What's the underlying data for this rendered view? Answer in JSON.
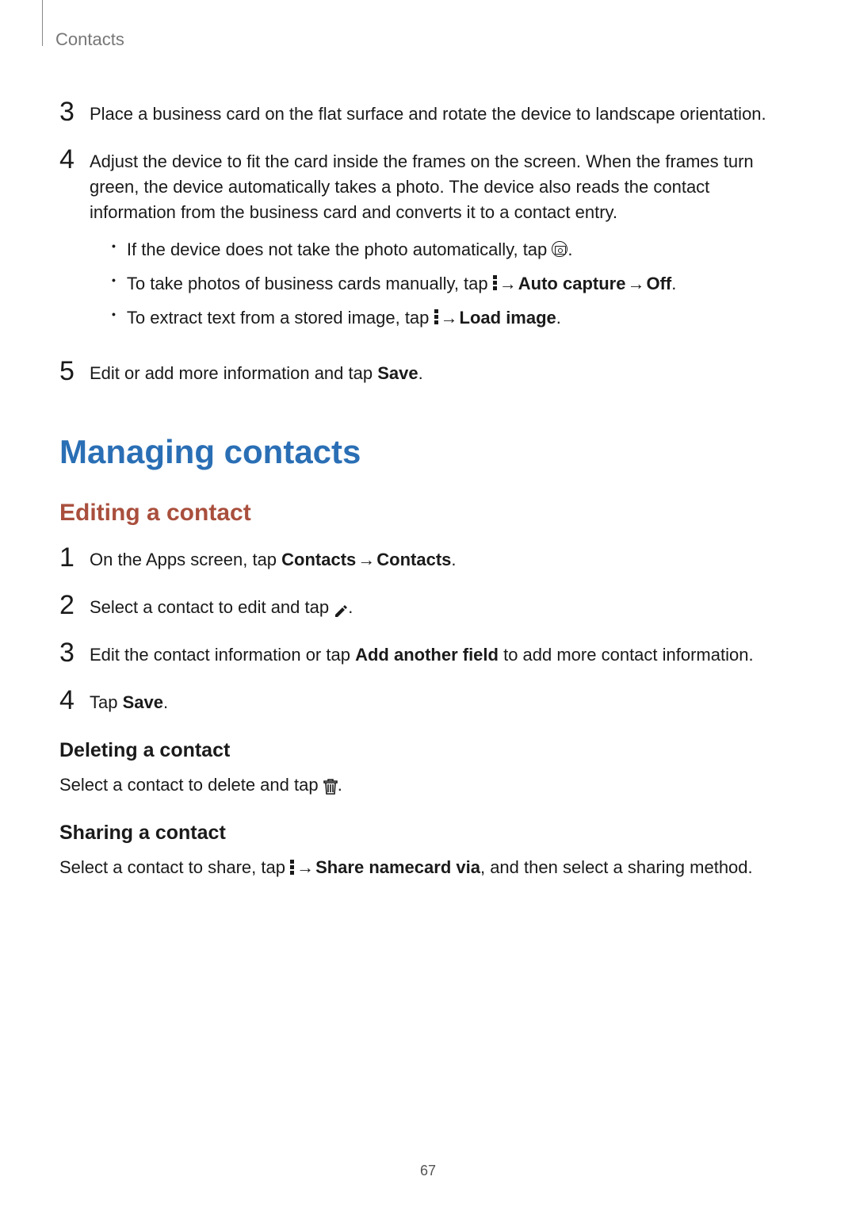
{
  "header": {
    "section_title": "Contacts"
  },
  "steps_first": {
    "3": {
      "num": "3",
      "text": "Place a business card on the flat surface and rotate the device to landscape orientation."
    },
    "4": {
      "num": "4",
      "text": "Adjust the device to fit the card inside the frames on the screen. When the frames turn green, the device automatically takes a photo. The device also reads the contact information from the business card and converts it to a contact entry.",
      "bullets": {
        "a_pre": "If the device does not take the photo automatically, tap ",
        "a_post": ".",
        "b_pre": "To take photos of business cards manually, tap ",
        "b_mid_arrow": " → ",
        "b_bold1": "Auto capture",
        "b_bold2": "Off",
        "b_dot": ".",
        "c_pre": "To extract text from a stored image, tap ",
        "c_arrow": " → ",
        "c_bold": "Load image",
        "c_dot": "."
      }
    },
    "5": {
      "num": "5",
      "text_pre": "Edit or add more information and tap ",
      "bold": "Save",
      "post": "."
    }
  },
  "heading_main": "Managing contacts",
  "heading_sub": "Editing a contact",
  "steps_edit": {
    "1": {
      "num": "1",
      "pre": "On the Apps screen, tap ",
      "b1": "Contacts",
      "arrow": " → ",
      "b2": "Contacts",
      "post": "."
    },
    "2": {
      "num": "2",
      "pre": "Select a contact to edit and tap ",
      "post": "."
    },
    "3": {
      "num": "3",
      "pre": "Edit the contact information or tap ",
      "b1": "Add another field",
      "post": " to add more contact information."
    },
    "4": {
      "num": "4",
      "pre": "Tap ",
      "b1": "Save",
      "post": "."
    }
  },
  "deleting": {
    "heading": "Deleting a contact",
    "pre": "Select a contact to delete and tap ",
    "post": "."
  },
  "sharing": {
    "heading": "Sharing a contact",
    "pre": "Select a contact to share, tap ",
    "arrow": " → ",
    "bold": "Share namecard via",
    "post": ", and then select a sharing method."
  },
  "page_number": "67"
}
